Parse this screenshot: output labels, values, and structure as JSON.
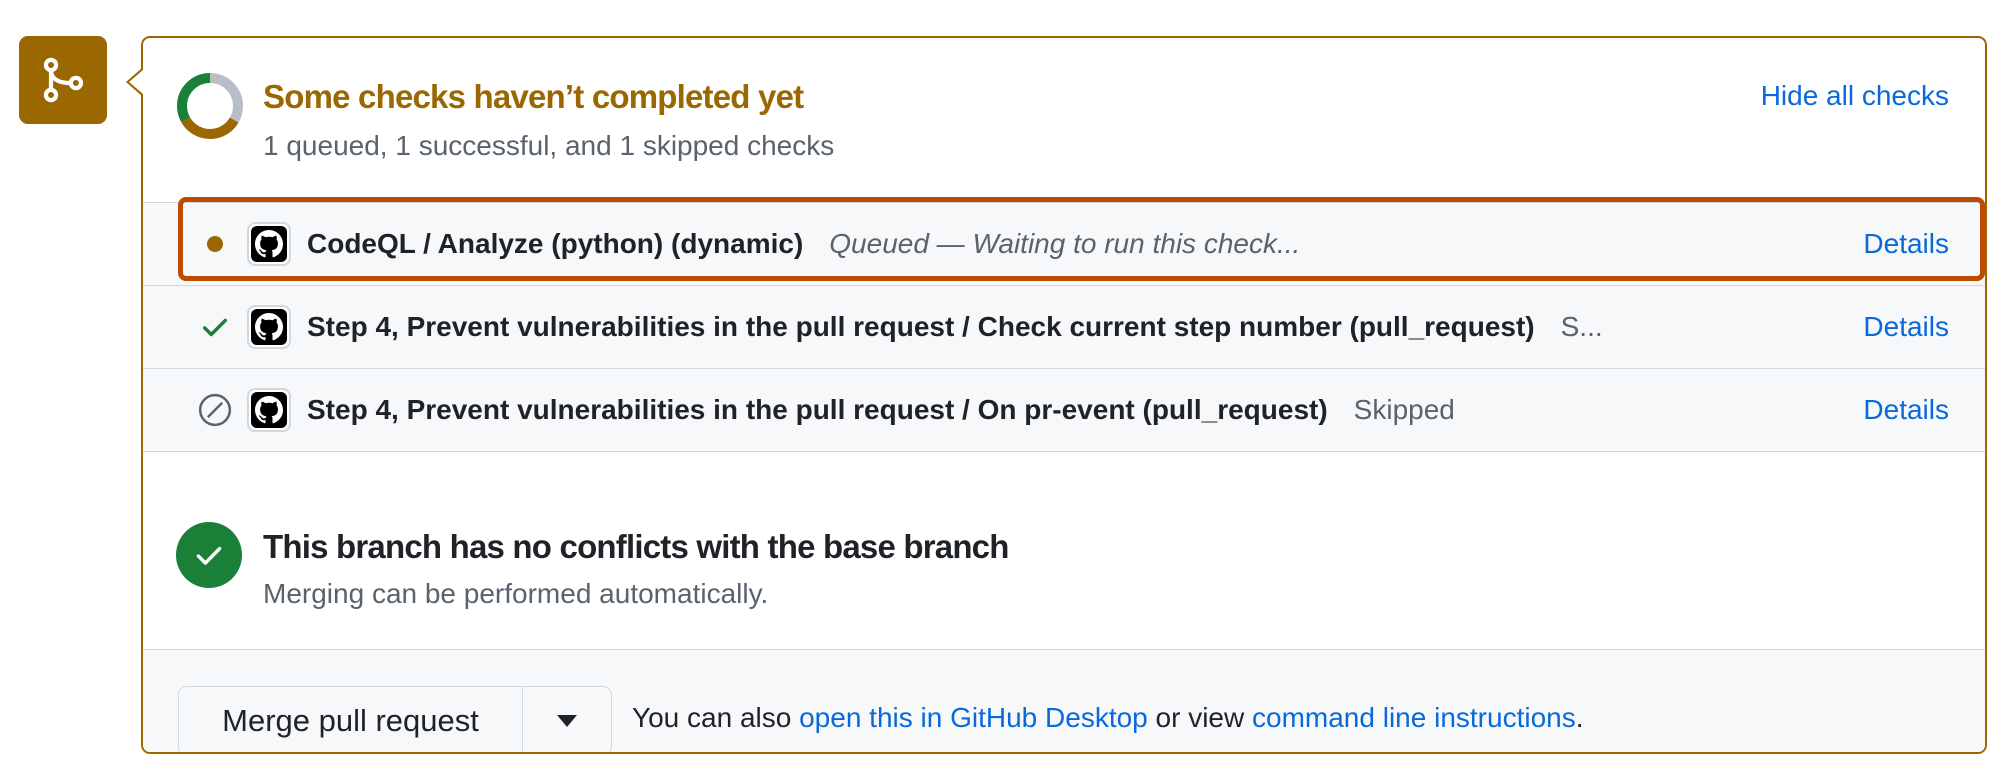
{
  "colors": {
    "attention": "#9a6700",
    "success": "#1a7f37",
    "link": "#0969da",
    "highlight": "#bc4c00",
    "muted": "#59636e",
    "neutral_segment": "#b7bec7"
  },
  "header": {
    "icon": "git-merge-icon",
    "title": "Some checks haven’t completed yet",
    "subtitle": "1 queued, 1 successful, and 1 skipped checks",
    "hide_all_label": "Hide all checks",
    "donut_segments": [
      {
        "status": "queued",
        "fraction": 0.333,
        "color": "#9a6700"
      },
      {
        "status": "successful",
        "fraction": 0.333,
        "color": "#1a7f37"
      },
      {
        "status": "skipped",
        "fraction": 0.333,
        "color": "#b7bec7"
      }
    ]
  },
  "checks": [
    {
      "status_icon": "queued-dot-icon",
      "avatar": "github-octocat-icon",
      "name": "CodeQL / Analyze (python) (dynamic)",
      "status_text": "Queued — Waiting to run this check...",
      "details_label": "Details",
      "highlighted": true
    },
    {
      "status_icon": "check-icon",
      "avatar": "github-octocat-icon",
      "name": "Step 4, Prevent vulnerabilities in the pull request / Check current step number (pull_request)",
      "status_text": "S...",
      "details_label": "Details"
    },
    {
      "status_icon": "skipped-icon",
      "avatar": "github-octocat-icon",
      "name": "Step 4, Prevent vulnerabilities in the pull request / On pr-event (pull_request)",
      "status_text": "Skipped",
      "details_label": "Details"
    }
  ],
  "conflicts": {
    "icon": "check-circle-icon",
    "title": "This branch has no conflicts with the base branch",
    "subtitle": "Merging can be performed automatically."
  },
  "merge": {
    "button_label": "Merge pull request",
    "dropdown_icon": "triangle-down-icon",
    "note_prefix": "You can also",
    "desktop_link": "open this in GitHub Desktop",
    "note_middle": "or view",
    "cli_link": "command line instructions",
    "note_suffix": "."
  }
}
